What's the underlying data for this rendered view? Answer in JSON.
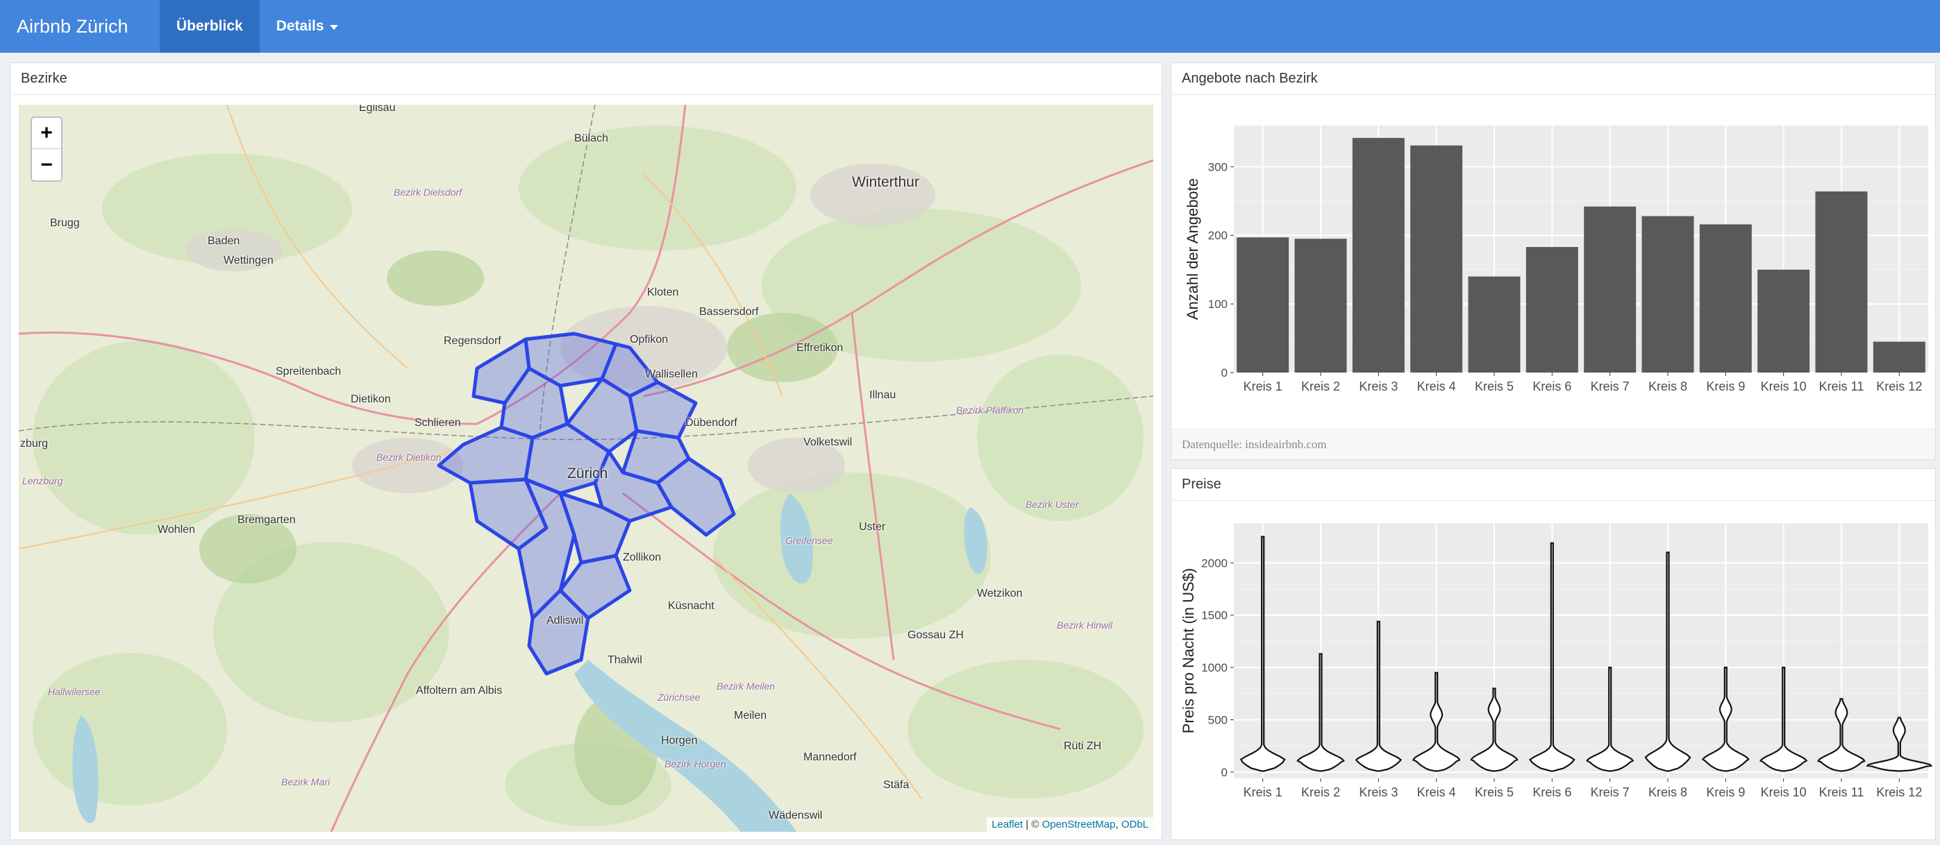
{
  "navbar": {
    "brand": "Airbnb Zürich",
    "tabs": [
      {
        "label": "Überblick",
        "active": true
      },
      {
        "label": "Details",
        "active": false
      }
    ],
    "colors": {
      "background": "#4285dc",
      "active_tab": "#2f6fc2"
    }
  },
  "map_panel": {
    "title": "Bezirke",
    "zoom_in": "+",
    "zoom_out": "−",
    "attribution": {
      "leaflet": "Leaflet",
      "separator": " | © ",
      "osm": "OpenStreetMap",
      "comma": ", ",
      "license": "ODbL"
    },
    "places": [
      {
        "name": "Eglisau"
      },
      {
        "name": "Bülach"
      },
      {
        "name": "Winterthur"
      },
      {
        "name": "Bezirk Dielsdorf"
      },
      {
        "name": "Brugg"
      },
      {
        "name": "Baden"
      },
      {
        "name": "Wettingen"
      },
      {
        "name": "Kloten"
      },
      {
        "name": "Bassersdorf"
      },
      {
        "name": "Regensdorf"
      },
      {
        "name": "Opfikon"
      },
      {
        "name": "Spreitenbach"
      },
      {
        "name": "Wallisellen"
      },
      {
        "name": "Effretikon"
      },
      {
        "name": "Dietikon"
      },
      {
        "name": "Illnau"
      },
      {
        "name": "Schlieren"
      },
      {
        "name": "Dübendorf"
      },
      {
        "name": "Bezirk Pfäffikon"
      },
      {
        "name": "Volketswil"
      },
      {
        "name": "Bezirk Dietikon"
      },
      {
        "name": "Zürich"
      },
      {
        "name": "Wohlen"
      },
      {
        "name": "Bremgarten"
      },
      {
        "name": "Uster"
      },
      {
        "name": "Greifensee"
      },
      {
        "name": "Zollikon"
      },
      {
        "name": "Wetzikon"
      },
      {
        "name": "Adliswil"
      },
      {
        "name": "Küsnacht"
      },
      {
        "name": "Gossau ZH"
      },
      {
        "name": "Thalwil"
      },
      {
        "name": "Bezirk Meilen"
      },
      {
        "name": "Affoltern am Albis"
      },
      {
        "name": "Zürichsee"
      },
      {
        "name": "Meilen"
      },
      {
        "name": "Horgen"
      },
      {
        "name": "Mannedorf"
      },
      {
        "name": "Rüti ZH"
      },
      {
        "name": "Bezirk Horgen"
      },
      {
        "name": "Stäfa"
      },
      {
        "name": "Wädenswil"
      },
      {
        "name": "Bezirk Mari"
      },
      {
        "name": "Hallwilersee"
      },
      {
        "name": "Lenzburg"
      },
      {
        "name": "zburg"
      },
      {
        "name": "Bezirk Hinwil"
      },
      {
        "name": "Bezirk Uster"
      }
    ]
  },
  "bar_panel": {
    "title": "Angebote nach Bezirk",
    "footer": "Datenquelle: insideairbnb.com"
  },
  "violin_panel": {
    "title": "Preise"
  },
  "chart_data": [
    {
      "type": "bar",
      "categories": [
        "Kreis 1",
        "Kreis 2",
        "Kreis 3",
        "Kreis 4",
        "Kreis 5",
        "Kreis 6",
        "Kreis 7",
        "Kreis 8",
        "Kreis 9",
        "Kreis 10",
        "Kreis 11",
        "Kreis 12"
      ],
      "values": [
        197,
        195,
        342,
        331,
        140,
        183,
        242,
        228,
        216,
        150,
        264,
        45
      ],
      "title": "",
      "xlabel": "",
      "ylabel": "Anzahl der Angebote",
      "ylim": [
        0,
        360
      ],
      "yticks": [
        0,
        100,
        200,
        300
      ],
      "bar_color": "#595959",
      "panel_bg": "#ebebeb",
      "grid": true
    },
    {
      "type": "violin",
      "categories": [
        "Kreis 1",
        "Kreis 2",
        "Kreis 3",
        "Kreis 4",
        "Kreis 5",
        "Kreis 6",
        "Kreis 7",
        "Kreis 8",
        "Kreis 9",
        "Kreis 10",
        "Kreis 11",
        "Kreis 12"
      ],
      "max": [
        2250,
        1130,
        1440,
        950,
        800,
        2190,
        1000,
        2100,
        1000,
        1000,
        700,
        520
      ],
      "mode": [
        100,
        100,
        100,
        110,
        110,
        100,
        100,
        120,
        110,
        100,
        100,
        60
      ],
      "secondary_mode": [
        null,
        null,
        null,
        550,
        600,
        null,
        null,
        null,
        600,
        null,
        570,
        400
      ],
      "title": "",
      "xlabel": "",
      "ylabel": "Preis pro Nacht (in US$)",
      "ylim": [
        -60,
        2380
      ],
      "yticks": [
        0,
        500,
        1000,
        1500,
        2000
      ],
      "panel_bg": "#ebebeb",
      "grid": true
    }
  ]
}
